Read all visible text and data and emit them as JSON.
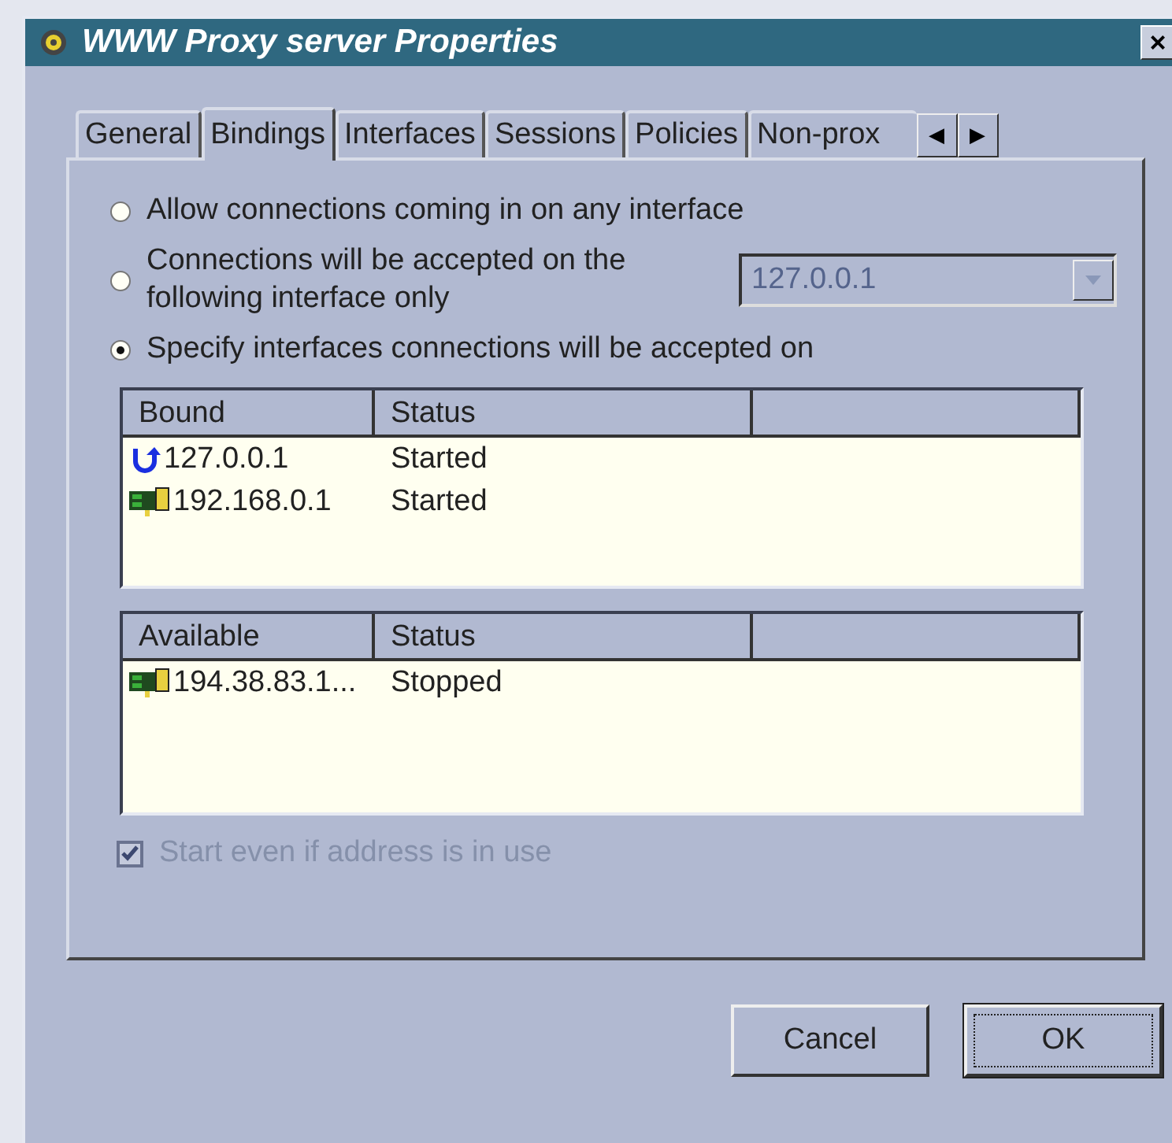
{
  "window": {
    "title": "WWW Proxy server Properties",
    "close": "×"
  },
  "tabs": [
    {
      "label": "General",
      "selected": false
    },
    {
      "label": "Bindings",
      "selected": true
    },
    {
      "label": "Interfaces",
      "selected": false
    },
    {
      "label": "Sessions",
      "selected": false
    },
    {
      "label": "Policies",
      "selected": false
    },
    {
      "label": "Non-prox",
      "selected": false
    }
  ],
  "tab_scroll": [
    "◀",
    "▶"
  ],
  "options": [
    {
      "label": "Allow connections coming in on any interface",
      "selected": false
    },
    {
      "label": "Connections will be accepted on the following interface only",
      "selected": false
    },
    {
      "label": "Specify interfaces connections will be accepted on",
      "selected": true
    }
  ],
  "interface_select": {
    "value": "127.0.0.1",
    "disabled": true
  },
  "bound_list": {
    "columns": [
      "Bound",
      "Status"
    ],
    "rows": [
      {
        "kind": "loopback",
        "address": "127.0.0.1",
        "status": "Started"
      },
      {
        "kind": "network",
        "address": "192.168.0.1",
        "status": "Started"
      }
    ]
  },
  "available_list": {
    "columns": [
      "Available",
      "Status"
    ],
    "rows": [
      {
        "kind": "network",
        "address": "194.38.83.1...",
        "status": "Stopped"
      }
    ]
  },
  "start_in_use": {
    "label": "Start even if address is in use",
    "checked": true,
    "disabled": true
  },
  "buttons": [
    {
      "label": "Cancel",
      "default": false
    },
    {
      "label": "OK",
      "default": true
    }
  ]
}
